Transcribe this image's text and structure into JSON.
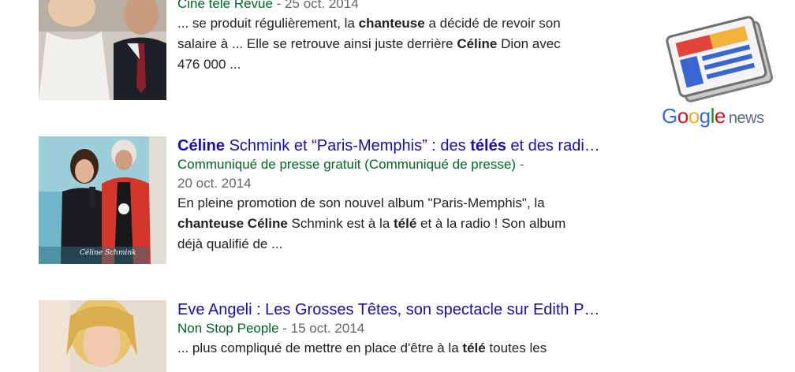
{
  "results": [
    {
      "title": "",
      "source": "Ciné télé Revue",
      "date": "25 oct. 2014",
      "snippet": [
        {
          "t": "... se produit régulièrement, la ",
          "b": false
        },
        {
          "t": "chanteuse",
          "b": true
        },
        {
          "t": " a décidé de revoir son",
          "b": false
        },
        {
          "t": "\nsalaire à ... Elle se retrouve ainsi juste derrière ",
          "b": false
        },
        {
          "t": "Céline",
          "b": true
        },
        {
          "t": " Dion avec",
          "b": false
        },
        {
          "t": "\n476 000 ...",
          "b": false
        }
      ]
    },
    {
      "title_parts": [
        {
          "t": "Céline",
          "b": true
        },
        {
          "t": " Schmink et “Paris-Memphis” : des ",
          "b": false
        },
        {
          "t": "télés",
          "b": true
        },
        {
          "t": " et des radi…",
          "b": false
        }
      ],
      "source": "Communiqué de presse gratuit (Communiqué de presse)",
      "date": "20 oct. 2014",
      "snippet": [
        {
          "t": "En pleine promotion de son nouvel album \"Paris-Memphis\", la",
          "b": false
        },
        {
          "t": "\n",
          "b": false
        },
        {
          "t": "chanteuse Céline",
          "b": true
        },
        {
          "t": " Schmink est à la ",
          "b": false
        },
        {
          "t": "télé",
          "b": true
        },
        {
          "t": " et à la radio ! Son album",
          "b": false
        },
        {
          "t": "\ndéjà qualifié de ...",
          "b": false
        }
      ],
      "thumb_caption": "Céline Schmink"
    },
    {
      "title_parts": [
        {
          "t": "Eve Angeli : Les Grosses Têtes, son spectacle sur Edith P…",
          "b": false
        }
      ],
      "source": "Non Stop People",
      "date": "15 oct. 2014",
      "snippet": [
        {
          "t": "... plus compliqué de mettre en place d'être à la ",
          "b": false
        },
        {
          "t": "télé",
          "b": true
        },
        {
          "t": " toutes les",
          "b": false
        }
      ]
    }
  ],
  "logo": {
    "google": "Google",
    "news": "news",
    "google_colors": [
      "#3369e8",
      "#d50f25",
      "#eeb211",
      "#3369e8",
      "#009925",
      "#d50f25"
    ]
  },
  "separator": " - "
}
